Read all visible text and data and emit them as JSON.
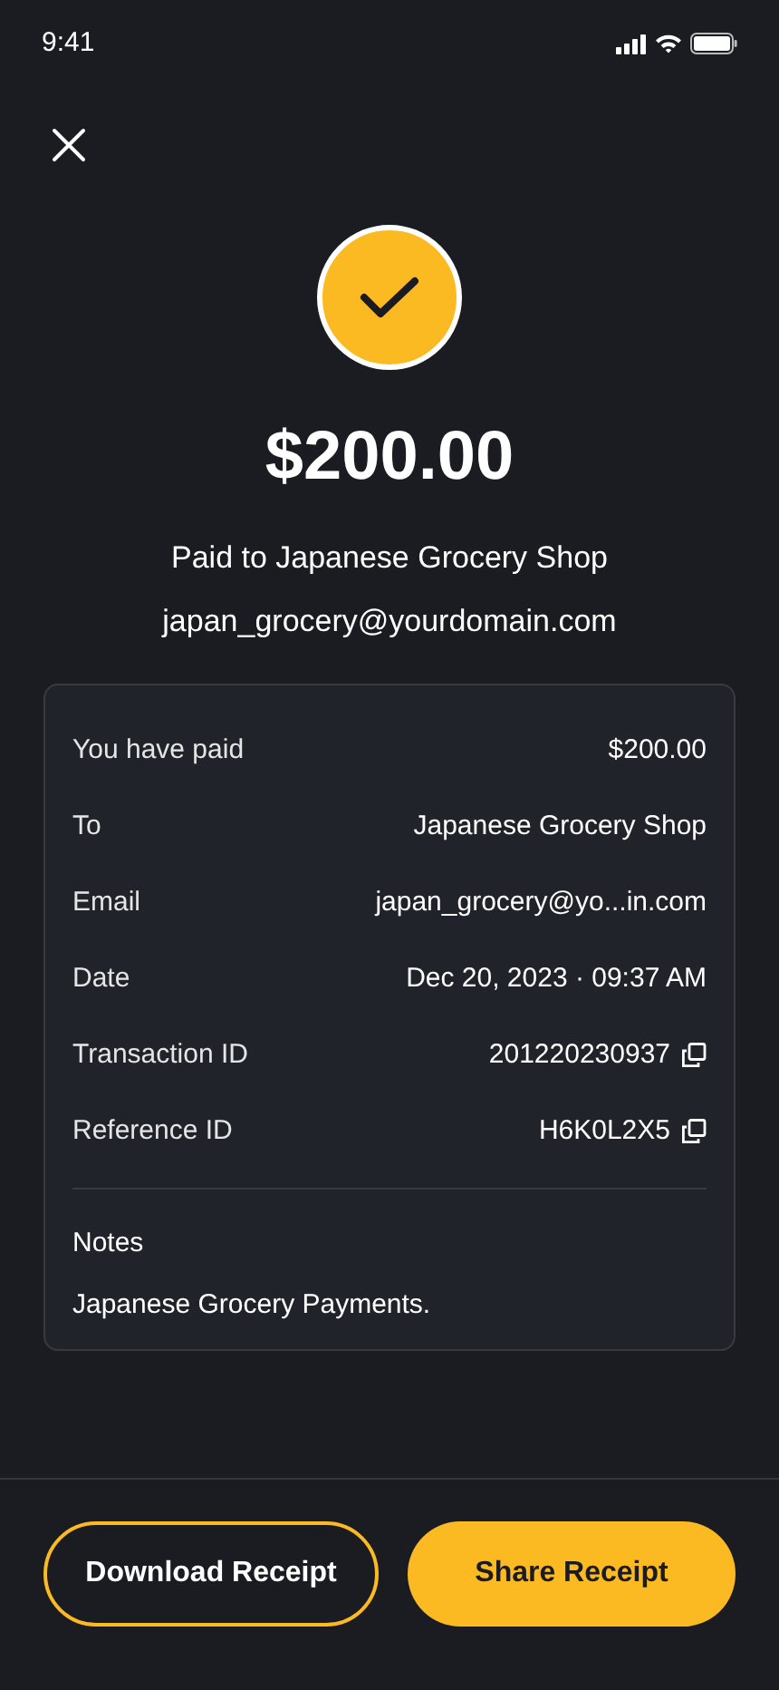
{
  "status_bar": {
    "time": "9:41"
  },
  "amount": "$200.00",
  "paid_to": "Paid to Japanese Grocery Shop",
  "email": "japan_grocery@yourdomain.com",
  "details": [
    {
      "label": "You have paid",
      "value": "$200.00",
      "kind": "text"
    },
    {
      "label": "To",
      "value": "Japanese Grocery Shop",
      "kind": "text"
    },
    {
      "label": "Email",
      "value": "japan_grocery@yo...in.com",
      "kind": "text"
    },
    {
      "label": "Date",
      "value": "Dec 20, 2023 · 09:37 AM",
      "kind": "text"
    },
    {
      "label": "Transaction ID",
      "value": "201220230937",
      "kind": "copyable"
    },
    {
      "label": "Reference ID",
      "value": "H6K0L2X5",
      "kind": "copyable"
    }
  ],
  "notes": {
    "label": "Notes",
    "text": "Japanese Grocery Payments."
  },
  "buttons": [
    {
      "label": "Download Receipt",
      "kind": "outline"
    },
    {
      "label": "Share Receipt",
      "kind": "filled"
    }
  ]
}
